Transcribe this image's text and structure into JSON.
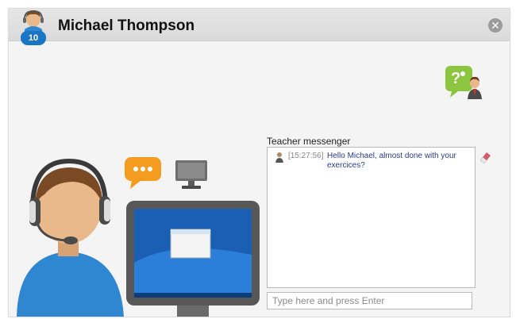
{
  "window": {
    "title": "Michael Thompson",
    "close_icon": "close-icon"
  },
  "student": {
    "badge_number": "10"
  },
  "messenger": {
    "label": "Teacher messenger",
    "messages": [
      {
        "time": "[15:27:56]",
        "text": "Hello Michael, almost done with your exercices?"
      }
    ],
    "input_placeholder": "Type here and press Enter"
  },
  "icons": {
    "help": "question-chat-person-icon",
    "chat": "chat-bubble-icon",
    "monitor": "monitor-icon",
    "eraser": "eraser-icon"
  },
  "colors": {
    "badge": "#1a75c4",
    "chat_bubble": "#f39c1f",
    "help_green": "#8cc63f",
    "message_text": "#2b3a8c"
  }
}
